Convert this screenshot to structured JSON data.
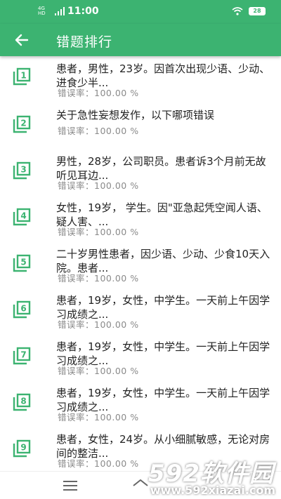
{
  "status_bar": {
    "time": "11:00",
    "network": "4G",
    "network_sub": "HD",
    "battery": "28"
  },
  "header": {
    "title": "错题排行"
  },
  "colors": {
    "primary": "#3cb371",
    "icon": "#3cb371",
    "rate_text": "#8a8a8a"
  },
  "items": [
    {
      "rank": "1",
      "text": "患者，男性，23岁。因首次出现少语、少动、进食少半...",
      "rate": "错误率：100.00 %"
    },
    {
      "rank": "2",
      "text": "关于急性妄想发作，以下哪项错误",
      "rate": "错误率：100.00 %"
    },
    {
      "rank": "3",
      "text": "男性，28岁，公司职员。患者诉3个月前无故听见耳边...",
      "rate": "错误率：100.00 %"
    },
    {
      "rank": "4",
      "text": "女性，19岁， 学生。因\"亚急起凭空闻人语、疑人害、...",
      "rate": "错误率：100.00 %"
    },
    {
      "rank": "5",
      "text": "二十岁男性患者，因少语、少动、少食10天入院。患者...",
      "rate": "错误率：100.00 %"
    },
    {
      "rank": "6",
      "text": "患者，19岁，女性，中学生。一天前上午因学习成绩之...",
      "rate": "错误率：100.00 %"
    },
    {
      "rank": "7",
      "text": "患者，19岁，女性，中学生。一天前上午因学习成绩之...",
      "rate": "错误率：100.00 %"
    },
    {
      "rank": "8",
      "text": "患者，19岁，女性，中学生。一天前上午因学习成绩之...",
      "rate": "错误率：100.00 %"
    },
    {
      "rank": "9",
      "text": "患者，女性，24岁。从小细腻敏感，无论对房间的整洁...",
      "rate": "错误率：100.00 %"
    }
  ],
  "nav_bar": {
    "menu_icon": "menu-icon",
    "home_icon": "home-icon"
  },
  "watermark": {
    "brand": "592软件园",
    "url": "www.592xiazai.com"
  }
}
